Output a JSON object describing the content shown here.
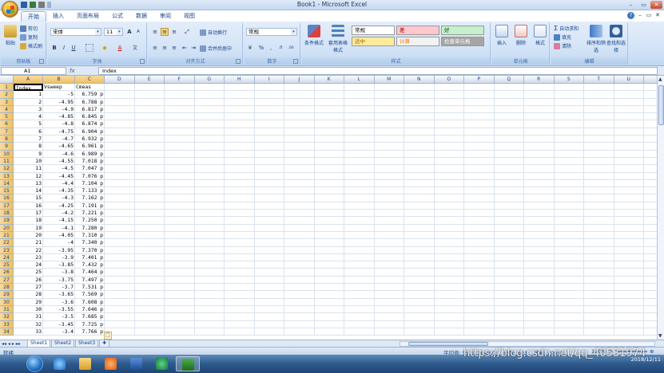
{
  "window": {
    "title": "Book1 - Microsoft Excel",
    "controls": [
      "–",
      "▭",
      "✕"
    ]
  },
  "ribbon": {
    "tabs": [
      "开始",
      "插入",
      "页面布局",
      "公式",
      "数据",
      "审阅",
      "视图"
    ],
    "active_tab": "开始",
    "clipboard": {
      "paste": "粘贴",
      "cut": "剪切",
      "copy": "复制",
      "format_painter": "格式刷",
      "label": "剪贴板"
    },
    "font": {
      "name": "宋体",
      "size": "11",
      "label": "字体",
      "bold": "B",
      "italic": "I",
      "underline": "U",
      "grow": "A",
      "shrink": "A",
      "color": "A",
      "fill": "◆"
    },
    "alignment": {
      "wrap": "自动换行",
      "merge": "合并后居中",
      "label": "对齐方式"
    },
    "number": {
      "format": "常规",
      "percent": "%",
      "comma": ",",
      "currency": "¥",
      "inc": ".0",
      "dec": ".00",
      "label": "数字"
    },
    "styles": {
      "conditional": "条件格式",
      "table": "套用表格格式",
      "cells": [
        {
          "text": "常规",
          "bg": "#ffffff",
          "fg": "#000000"
        },
        {
          "text": "差",
          "bg": "#ffc7ce",
          "fg": "#9c0006"
        },
        {
          "text": "好",
          "bg": "#c6efce",
          "fg": "#006100"
        },
        {
          "text": "适中",
          "bg": "#ffeb9c",
          "fg": "#9c6500"
        },
        {
          "text": "计算",
          "bg": "#f2f2f2",
          "fg": "#fa7d00"
        },
        {
          "text": "检查单元格",
          "bg": "#a5a5a5",
          "fg": "#ffffff"
        }
      ],
      "label": "样式"
    },
    "cells_group": {
      "insert": "插入",
      "delete": "删除",
      "format": "格式",
      "label": "单元格"
    },
    "editing": {
      "autosum": "自动求和",
      "fill": "填充",
      "clear": "清除",
      "sort": "排序和筛选",
      "find": "查找和选择",
      "label": "编辑"
    }
  },
  "formula_bar": {
    "name_box": "A1",
    "fx": "fx",
    "content": "Index"
  },
  "columns": [
    "A",
    "B",
    "C",
    "D",
    "E",
    "F",
    "G",
    "H",
    "I",
    "J",
    "K",
    "L",
    "M",
    "N",
    "O",
    "P",
    "Q",
    "R",
    "S",
    "T",
    "U",
    "V"
  ],
  "selected_column_headers": [
    "A",
    "B",
    "C"
  ],
  "header_row": [
    "Index",
    "Vsweep",
    "Cmeas"
  ],
  "rows": [
    [
      "1",
      "-5",
      "6.759 p"
    ],
    [
      "2",
      "-4.95",
      "6.788 p"
    ],
    [
      "3",
      "-4.9",
      "6.817 p"
    ],
    [
      "4",
      "-4.85",
      "6.845 p"
    ],
    [
      "5",
      "-4.8",
      "6.874 p"
    ],
    [
      "6",
      "-4.75",
      "6.904 p"
    ],
    [
      "7",
      "-4.7",
      "6.932 p"
    ],
    [
      "8",
      "-4.65",
      "6.961 p"
    ],
    [
      "9",
      "-4.6",
      "6.989 p"
    ],
    [
      "10",
      "-4.55",
      "7.018 p"
    ],
    [
      "11",
      "-4.5",
      "7.047 p"
    ],
    [
      "12",
      "-4.45",
      "7.076 p"
    ],
    [
      "13",
      "-4.4",
      "7.104 p"
    ],
    [
      "14",
      "-4.35",
      "7.133 p"
    ],
    [
      "15",
      "-4.3",
      "7.162 p"
    ],
    [
      "16",
      "-4.25",
      "7.191 p"
    ],
    [
      "17",
      "-4.2",
      "7.221 p"
    ],
    [
      "18",
      "-4.15",
      "7.250 p"
    ],
    [
      "19",
      "-4.1",
      "7.280 p"
    ],
    [
      "20",
      "-4.05",
      "7.310 p"
    ],
    [
      "21",
      "-4",
      "7.340 p"
    ],
    [
      "22",
      "-3.95",
      "7.370 p"
    ],
    [
      "23",
      "-3.9",
      "7.401 p"
    ],
    [
      "24",
      "-3.85",
      "7.432 p"
    ],
    [
      "25",
      "-3.8",
      "7.464 p"
    ],
    [
      "26",
      "-3.75",
      "7.497 p"
    ],
    [
      "27",
      "-3.7",
      "7.531 p"
    ],
    [
      "28",
      "-3.65",
      "7.569 p"
    ],
    [
      "29",
      "-3.6",
      "7.608 p"
    ],
    [
      "30",
      "-3.55",
      "7.646 p"
    ],
    [
      "31",
      "-3.5",
      "7.685 p"
    ],
    [
      "32",
      "-3.45",
      "7.725 p"
    ],
    [
      "33",
      "-3.4",
      "7.766 p"
    ]
  ],
  "sheets": [
    "Sheet1",
    "Sheet2",
    "Sheet3"
  ],
  "active_sheet": "Sheet1",
  "status": {
    "mode": "就绪",
    "average": "平均值: 55.51104972",
    "count": "计数: 603",
    "sum": "求和: 20095",
    "zoom": "100%"
  },
  "taskbar": {
    "date": "2018/12/11",
    "time": ""
  },
  "watermark": "https://blog.csdn.net/qq_40531974"
}
